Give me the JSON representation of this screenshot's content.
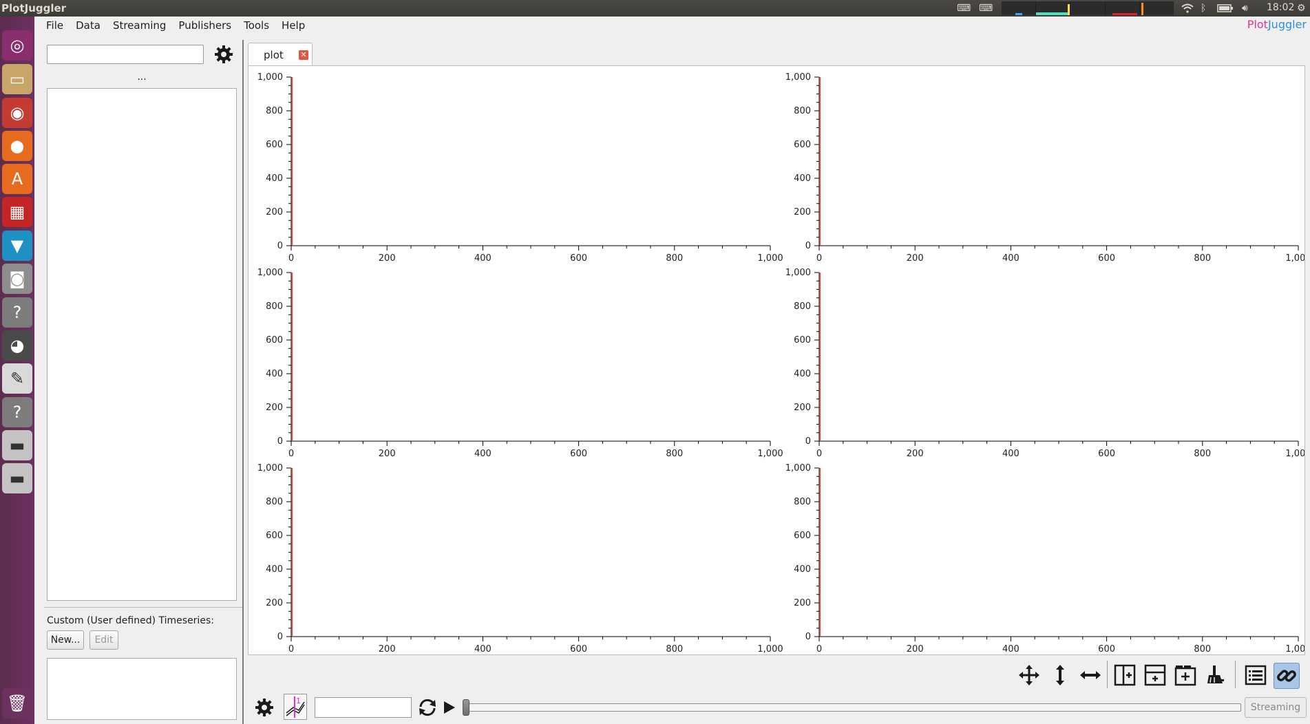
{
  "top_panel": {
    "title": "PlotJuggler",
    "clock": "18:02"
  },
  "brand": {
    "part1": "Plot",
    "part2": "Juggler",
    "color1": "#e0359a",
    "color2": "#2f8fd8"
  },
  "menu": [
    "File",
    "Data",
    "Streaming",
    "Publishers",
    "Tools",
    "Help"
  ],
  "launcher": [
    "ubuntu-icon",
    "files-icon",
    "dvd-icon",
    "firefox-icon",
    "software-center-icon",
    "impress-icon",
    "rviz-icon",
    "camera-icon",
    "unknown-app-icon",
    "eye-icon",
    "text-editor-icon",
    "unknown-app-icon",
    "drive-icon",
    "drive-icon",
    "trash-icon"
  ],
  "left_panel": {
    "filter_value": "",
    "ellipsis": "...",
    "custom_label": "Custom (User defined) Timeseries:",
    "new_button": "New...",
    "edit_button": "Edit"
  },
  "tab": {
    "label": "plot"
  },
  "plots": {
    "count": 6,
    "xticks": [
      "0",
      "200",
      "400",
      "600",
      "800",
      "1,000"
    ],
    "yticks": [
      "0",
      "200",
      "400",
      "600",
      "800",
      "1,000"
    ],
    "xlim": [
      0,
      1000
    ],
    "ylim": [
      0,
      1000
    ]
  },
  "bottom": {
    "time_value": "",
    "streaming_label": "Streaming"
  },
  "colors": {
    "accent_red": "#e0573f",
    "link_active": "#aac6e6"
  }
}
